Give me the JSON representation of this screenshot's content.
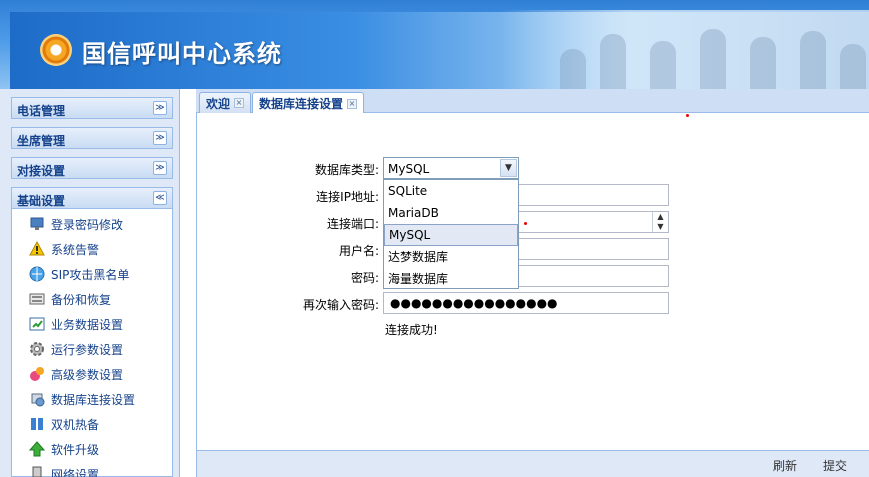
{
  "header": {
    "title": "国信呼叫中心系统"
  },
  "sidebar": {
    "sections": [
      {
        "label": "电话管理",
        "toggle": "≫"
      },
      {
        "label": "坐席管理",
        "toggle": "≫"
      },
      {
        "label": "对接设置",
        "toggle": "≫"
      },
      {
        "label": "基础设置",
        "toggle": "≪"
      }
    ],
    "items": [
      {
        "label": "登录密码修改",
        "icon": "monitor-icon"
      },
      {
        "label": "系统告警",
        "icon": "warning-icon"
      },
      {
        "label": "SIP攻击黑名单",
        "icon": "globe-icon"
      },
      {
        "label": "备份和恢复",
        "icon": "backup-icon"
      },
      {
        "label": "业务数据设置",
        "icon": "data-icon"
      },
      {
        "label": "运行参数设置",
        "icon": "gear-icon"
      },
      {
        "label": "高级参数设置",
        "icon": "advanced-icon"
      },
      {
        "label": "数据库连接设置",
        "icon": "database-icon"
      },
      {
        "label": "双机热备",
        "icon": "server-icon"
      },
      {
        "label": "软件升级",
        "icon": "upgrade-icon"
      },
      {
        "label": "网络设置",
        "icon": "network-icon"
      }
    ]
  },
  "tabs": [
    {
      "label": "欢迎",
      "close": "×"
    },
    {
      "label": "数据库连接设置",
      "close": "×"
    }
  ],
  "form": {
    "db_type_label": "数据库类型:",
    "db_type_value": "MySQL",
    "db_type_options": [
      "SQLite",
      "MariaDB",
      "MySQL",
      "达梦数据库",
      "海量数据库"
    ],
    "ip_label": "连接IP地址:",
    "port_label": "连接端口:",
    "user_label": "用户名:",
    "password_label": "密码:",
    "password_repeat_label": "再次输入密码:",
    "password_repeat_value": "●●●●●●●●●●●●●●●●",
    "status_message": "连接成功!"
  },
  "footer": {
    "refresh": "刷新",
    "submit": "提交"
  }
}
